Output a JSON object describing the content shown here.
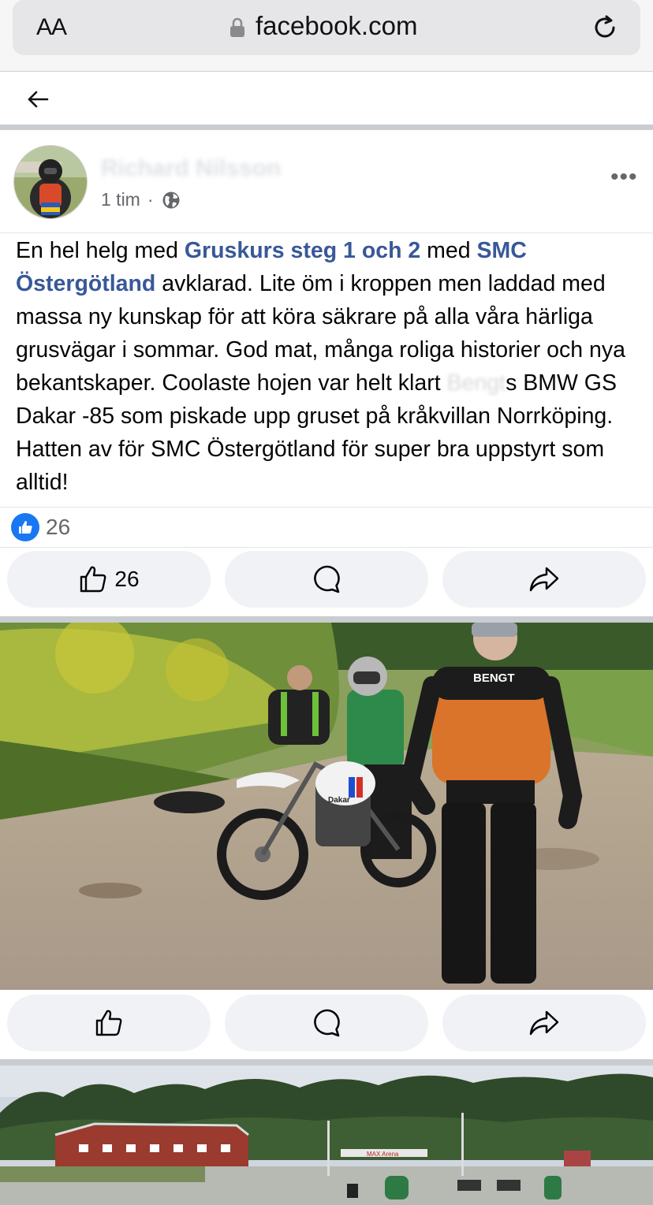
{
  "browser": {
    "text_size_label": "AA",
    "domain": "facebook.com"
  },
  "post": {
    "time": "1 tim",
    "separator": "·",
    "more_label": "•••",
    "text": {
      "p1": "En hel helg med ",
      "link1": "Gruskurs steg 1 och 2",
      "p2": " med ",
      "link2": "SMC Östergötland",
      "p3": " avklarad. Lite öm i kroppen men laddad med massa ny kunskap för att köra säkrare på alla våra härliga grusvägar i sommar. God mat, många roliga historier och nya bekantskaper. Coolaste hojen var helt klart ",
      "p4": "s BMW GS Dakar -85 som piskade upp gruset på kråkvillan Norrköping. Hatten av för SMC Östergötland för super bra uppstyrt som alltid!"
    },
    "reaction_count": "26",
    "like_count": "26"
  },
  "photos": [
    {
      "jacket_text": "BENGT",
      "bike_text": "Dakar"
    },
    {
      "sign_text": "MAX Arena"
    }
  ]
}
